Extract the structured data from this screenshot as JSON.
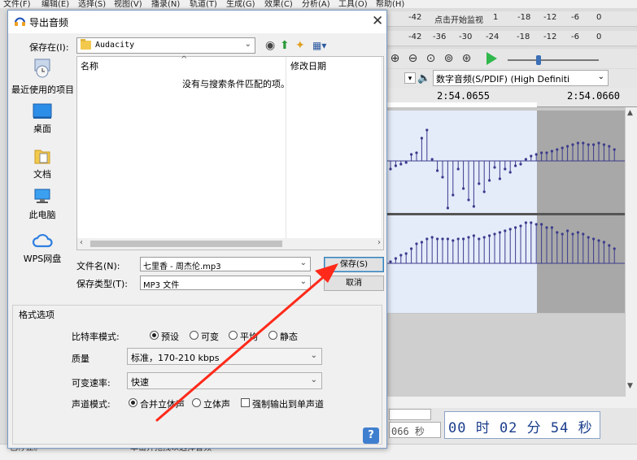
{
  "background_app": {
    "menu": [
      "文件(F)",
      "编辑(E)",
      "选择(S)",
      "视图(V)",
      "播录(N)",
      "轨道(T)",
      "生成(G)",
      "效果(C)",
      "分析(A)",
      "工具(O)",
      "帮助(H)"
    ],
    "meter_row1": {
      "scale": [
        "-42",
        "点击开始监视",
        "1",
        "-18",
        "-12",
        "-6",
        "0"
      ]
    },
    "meter_row2": {
      "scale": [
        "-42",
        "-36",
        "-30",
        "-24",
        "-18",
        "-12",
        "-6",
        "0"
      ]
    },
    "output_device": "数字音频(S/PDIF) (High Definiti",
    "ruler_times": [
      "2:54.0655",
      "2:54.0660"
    ],
    "selection_partial": "066 秒",
    "audio_position": "00 时 02 分 54 秒",
    "status_left": "已停止。",
    "status_middle": "单击并拖拽以选择音频"
  },
  "dialog": {
    "title": "导出音频",
    "close_glyph": "✕",
    "save_in_label": "保存在(I):",
    "save_in_value": "Audacity",
    "places": [
      "最近使用的项目",
      "桌面",
      "文档",
      "此电脑",
      "WPS网盘"
    ],
    "columns": {
      "name": "名称",
      "date": "修改日期"
    },
    "empty_message": "没有与搜索条件匹配的项。",
    "filename_label": "文件名(N):",
    "filename_value": "七里香 - 周杰伦.mp3",
    "filetype_label": "保存类型(T):",
    "filetype_value": "MP3 文件",
    "save_button": "保存(S)",
    "cancel_button": "取消",
    "format_options": {
      "title": "格式选项",
      "bitrate_label": "比特率模式:",
      "bitrate_modes": [
        "预设",
        "可变",
        "平均",
        "静态"
      ],
      "bitrate_selected": "预设",
      "quality_label": "质量",
      "quality_value": "标准，170-210 kbps",
      "vbr_speed_label": "可变速率:",
      "vbr_speed_value": "快速",
      "channel_label": "声道模式:",
      "channel_modes": [
        "合并立体声",
        "立体声"
      ],
      "channel_selected": "合并立体声",
      "force_mono_label": "强制输出到单声道",
      "force_mono_checked": false
    },
    "help_glyph": "?"
  },
  "colors": {
    "annotation_arrow": "#ff2a1a",
    "selection_bg": "#e4ecfa",
    "sample_stem": "#3b3b8c",
    "play_green": "#30b84c",
    "help_blue": "#3f7fcf"
  }
}
